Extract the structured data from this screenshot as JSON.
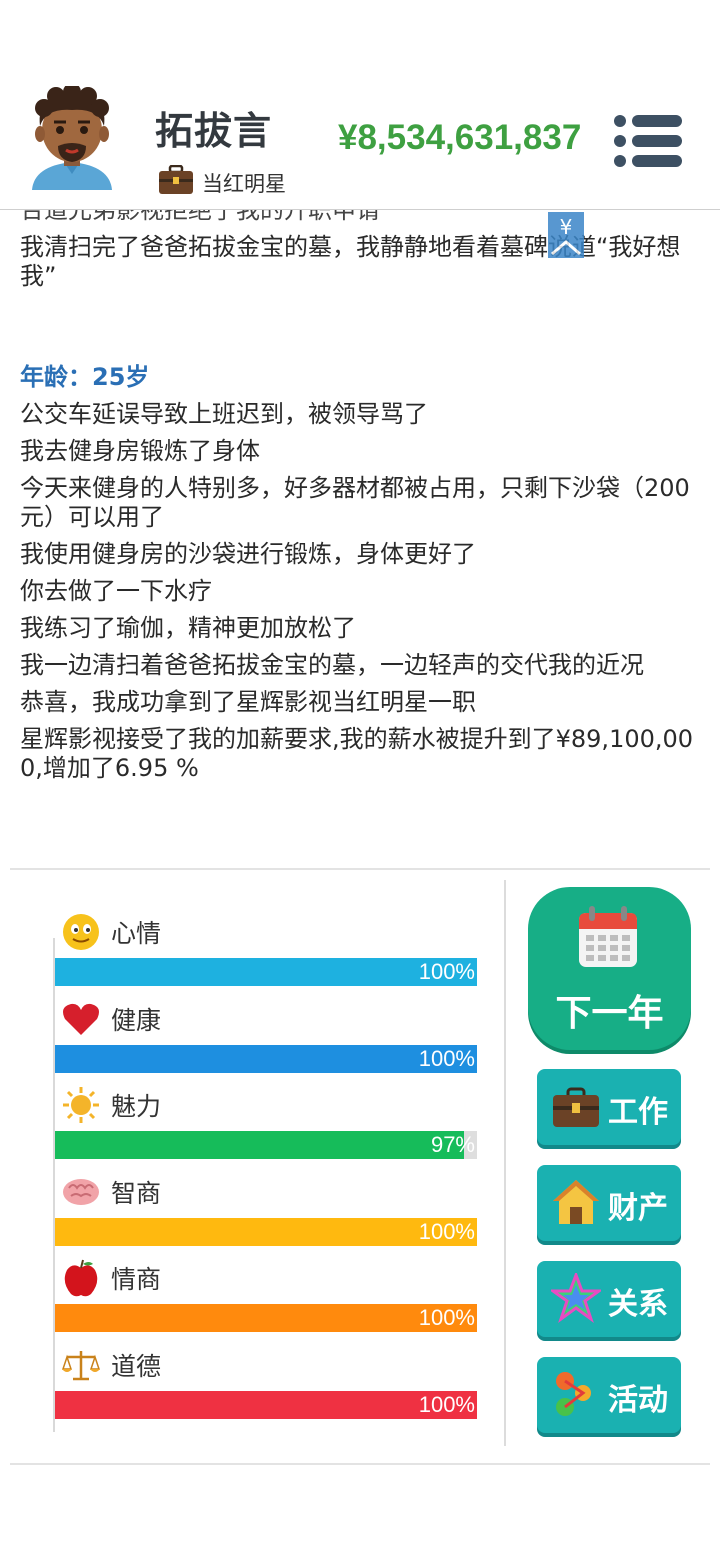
{
  "header": {
    "player_name": "拓拔言",
    "job_title": "当红明星",
    "money": "¥8,534,631,837",
    "icons": {
      "avatar": "avatar-icon",
      "job": "briefcase-icon",
      "menu": "menu-icon"
    }
  },
  "log": {
    "cut_line": "合道兄弟影视拒绝了我的升职申请",
    "lines_before": [
      "我清扫完了爸爸拓拔金宝的墓，我静静地看着墓碑说道“我好想我”"
    ],
    "age_label": "年龄：25岁",
    "lines_after": [
      "公交车延误导致上班迟到，被领导骂了",
      "我去健身房锻炼了身体",
      "今天来健身的人特别多，好多器材都被占用，只剩下沙袋（200元）可以用了",
      "我使用健身房的沙袋进行锻炼，身体更好了",
      "你去做了一下水疗",
      "我练习了瑜伽，精神更加放松了",
      "我一边清扫着爸爸拓拔金宝的墓，一边轻声的交代我的近况",
      "恭喜，我成功拿到了星辉影视当红明星一职",
      "星辉影视接受了我的加薪要求,我的薪水被提升到了¥89,100,000,增加了6.95 %"
    ],
    "scroll_button_icon": "yen-scroll-up-icon"
  },
  "stats": [
    {
      "name": "心情",
      "value_label": "100%",
      "level": 1.0,
      "color": "#1eb1e0",
      "icon": "smiley-icon"
    },
    {
      "name": "健康",
      "value_label": "100%",
      "level": 1.0,
      "color": "#1e8fe0",
      "icon": "heart-icon"
    },
    {
      "name": "魅力",
      "value_label": "97%",
      "level": 0.97,
      "color": "#16bc5a",
      "icon": "sun-icon"
    },
    {
      "name": "智商",
      "value_label": "100%",
      "level": 1.0,
      "color": "#ffb90f",
      "icon": "brain-icon"
    },
    {
      "name": "情商",
      "value_label": "100%",
      "level": 1.0,
      "color": "#ff8a0d",
      "icon": "apple-icon"
    },
    {
      "name": "道德",
      "value_label": "100%",
      "level": 1.0,
      "color": "#ef3142",
      "icon": "scales-icon"
    }
  ],
  "actions": {
    "next_year": {
      "label": "下一年",
      "icon": "calendar-icon"
    },
    "buttons": [
      {
        "label": "工作",
        "icon": "briefcase-icon"
      },
      {
        "label": "财产",
        "icon": "house-icon"
      },
      {
        "label": "关系",
        "icon": "star-icon"
      },
      {
        "label": "活动",
        "icon": "activity-icon"
      }
    ]
  }
}
